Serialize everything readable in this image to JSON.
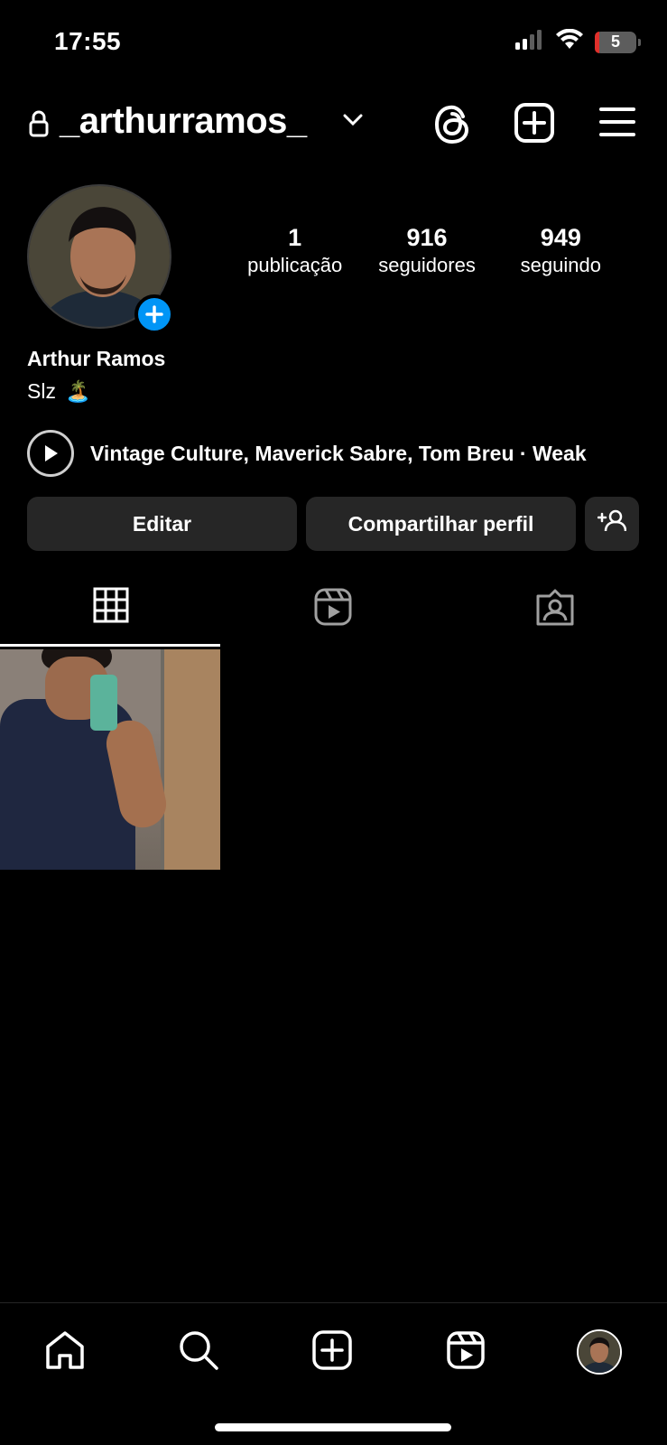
{
  "status_bar": {
    "time": "17:55",
    "battery_level": "5",
    "icons": [
      "signal-icon",
      "wifi-icon",
      "battery-icon"
    ]
  },
  "header": {
    "username": "_arthurramos_",
    "icons": [
      "lock-icon",
      "chevron-down-icon",
      "threads-icon",
      "create-post-icon",
      "menu-icon"
    ]
  },
  "profile": {
    "stats": [
      {
        "value": "1",
        "label": "publicação"
      },
      {
        "value": "916",
        "label": "seguidores"
      },
      {
        "value": "949",
        "label": "seguindo"
      }
    ],
    "full_name": "Arthur Ramos",
    "bio": "Slz",
    "bio_emoji": "🏝️",
    "music": "Vintage Culture, Maverick Sabre, Tom Breu · Weak"
  },
  "actions": {
    "edit": "Editar",
    "share": "Compartilhar perfil",
    "add_icon": "add-person-icon"
  },
  "tabs": {
    "items": [
      "grid-icon",
      "reels-tab-icon",
      "tagged-icon"
    ],
    "active": 0
  },
  "posts": {
    "count": 1
  },
  "bottom_nav": {
    "items": [
      "home-icon",
      "search-icon",
      "create-icon",
      "reels-icon",
      "profile-avatar"
    ]
  }
}
